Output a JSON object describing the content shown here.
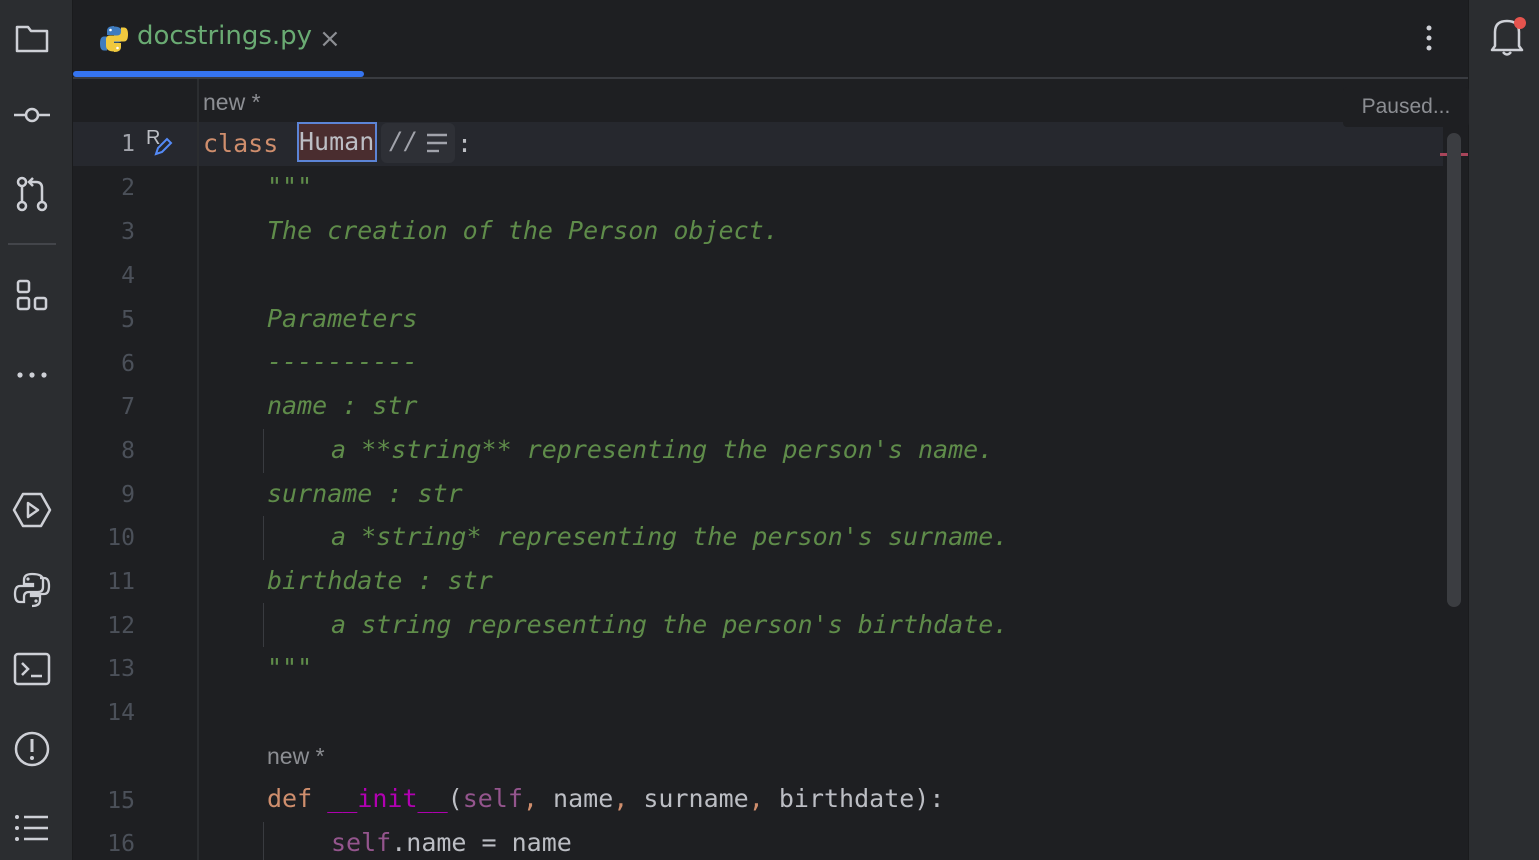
{
  "tab": {
    "file_name": "docstrings.py",
    "close_glyph": "×"
  },
  "editor": {
    "inlay_new_1": "new *",
    "inlay_new_2": "new *",
    "paused": "Paused...",
    "git_author_glyph": "R",
    "render_toggle_glyph": "//",
    "line_numbers": [
      "1",
      "2",
      "3",
      "4",
      "5",
      "6",
      "7",
      "8",
      "9",
      "10",
      "11",
      "12",
      "13",
      "14",
      "15",
      "16"
    ],
    "lines": {
      "l1_kw": "class",
      "l1_name": "Human",
      "l1_colon": ":",
      "l2": "\"\"\"",
      "l3": "The creation of the Person object.",
      "l5": "Parameters",
      "l6": "----------",
      "l7": "name : str",
      "l8": "a **string** representing the person's name.",
      "l9": "surname : str",
      "l10": "a *string* representing the person's surname.",
      "l11": "birthdate : str",
      "l12": "a string representing the person's birthdate.",
      "l13": "\"\"\"",
      "l15_kw": "def",
      "l15_fn": "__init__",
      "l15_open": "(",
      "l15_self": "self",
      "l15_comma1": ",",
      "l15_name": " name",
      "l15_comma2": ",",
      "l15_surname": " surname",
      "l15_comma3": ",",
      "l15_rest": " birthdate):",
      "l16_self": "self",
      "l16_rest": ".name = name"
    }
  },
  "colors": {
    "accent": "#3574f0",
    "tab_text": "#6aab73",
    "docstring": "#5f8c4a",
    "keyword": "#cf8e6d",
    "magic_method": "#b200b2",
    "self": "#94558d",
    "notification_dot": "#e5544e"
  },
  "icons": {
    "left_strip": [
      "folder-icon",
      "commit-icon",
      "pull-requests-icon",
      "structure-icon",
      "more-icon",
      "run-icon",
      "python-console-icon",
      "terminal-icon",
      "problems-icon",
      "todo-icon"
    ],
    "right_strip": [
      "notifications-icon"
    ]
  }
}
